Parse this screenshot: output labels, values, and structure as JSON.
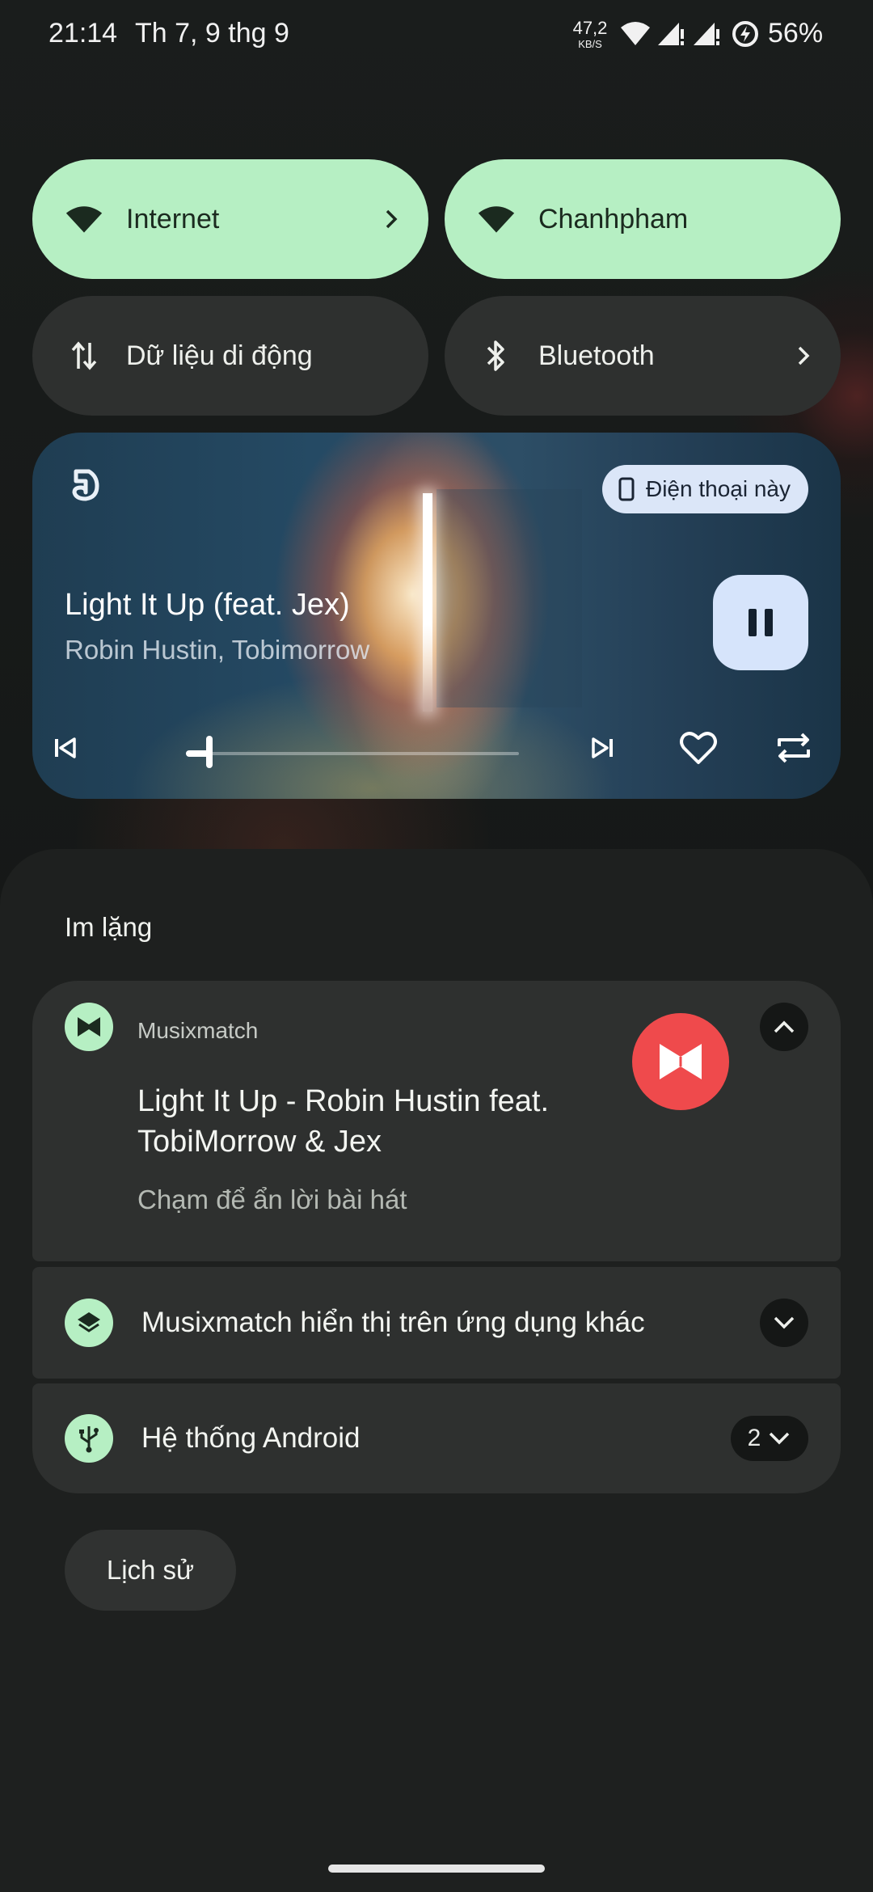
{
  "status_bar": {
    "time": "21:14",
    "date": "Th 7, 9 thg 9",
    "net_speed_value": "47,2",
    "net_speed_unit": "KB/S",
    "battery_percent": "56%",
    "icons": [
      "wifi-icon",
      "signal-icon",
      "signal-icon",
      "battery-saver-icon"
    ]
  },
  "quick_tiles": [
    {
      "label": "Internet",
      "icon": "wifi-icon",
      "active": true,
      "has_chevron": true
    },
    {
      "label": "Chanhpham",
      "icon": "wifi-icon",
      "active": true,
      "has_chevron": false
    },
    {
      "label": "Dữ liệu di động",
      "icon": "mobile-data-icon",
      "active": false,
      "has_chevron": false
    },
    {
      "label": "Bluetooth",
      "icon": "bluetooth-icon",
      "active": false,
      "has_chevron": true
    }
  ],
  "media": {
    "app_icon": "music-note-icon",
    "output_device": "Điện thoại này",
    "title": "Light It Up (feat. Jex)",
    "artist": "Robin Hustin, Tobimorrow",
    "progress": 0.07,
    "controls": [
      "previous-icon",
      "next-icon",
      "heart-icon",
      "repeat-icon"
    ],
    "state": "playing"
  },
  "notifications": {
    "section_label": "Im lặng",
    "items": [
      {
        "app": "Musixmatch",
        "title": "Light It Up - Robin Hustin feat. TobiMorrow & Jex",
        "text": "Chạm để ẩn lời bài hát",
        "expanded": true
      },
      {
        "label": "Musixmatch hiển thị trên ứng dụng khác"
      },
      {
        "label": "Hệ thống Android",
        "count": "2"
      }
    ],
    "history_button": "Lịch sử"
  },
  "colors": {
    "accent_green": "#b6efc3",
    "tile_dark": "#2e302f",
    "musixmatch_red": "#ef4a4c",
    "media_button": "#d6e4fb"
  }
}
